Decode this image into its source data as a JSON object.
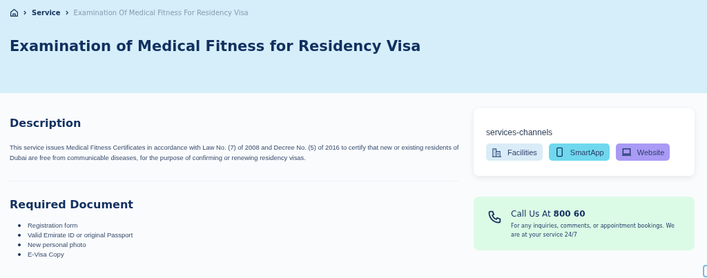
{
  "breadcrumb": [
    {
      "label": "Service",
      "current": false
    },
    {
      "label": "Examination Of Medical Fitness For Residency Visa",
      "current": true
    }
  ],
  "title": "Examination of Medical Fitness for Residency Visa",
  "description": {
    "heading": "Description",
    "text": "This service issues Medical Fitness Certificates in accordance with Law No. (7) of 2008 and Decree No. (5) of 2016 to certify that new or existing residents of Dubai are free from communicable diseases, for the purpose of confirming or renewing residency visas."
  },
  "required_document": {
    "heading": "Required Document",
    "items": [
      "Registration form",
      "Valid Emirate ID or original Passport",
      "New personal photo",
      "E-Visa Copy"
    ]
  },
  "channels": {
    "title": "services-channels",
    "items": [
      {
        "label": "Facilities",
        "kind": "building",
        "color": "#d9ecf7"
      },
      {
        "label": "SmartApp",
        "kind": "phone",
        "color": "#6fd8ee"
      },
      {
        "label": "Website",
        "kind": "laptop",
        "color": "#a99af5"
      }
    ]
  },
  "call": {
    "title": "Call Us At **800 60**",
    "text": "For any inquiries, comments, or appointment bookings. We are at your service 24/7"
  }
}
